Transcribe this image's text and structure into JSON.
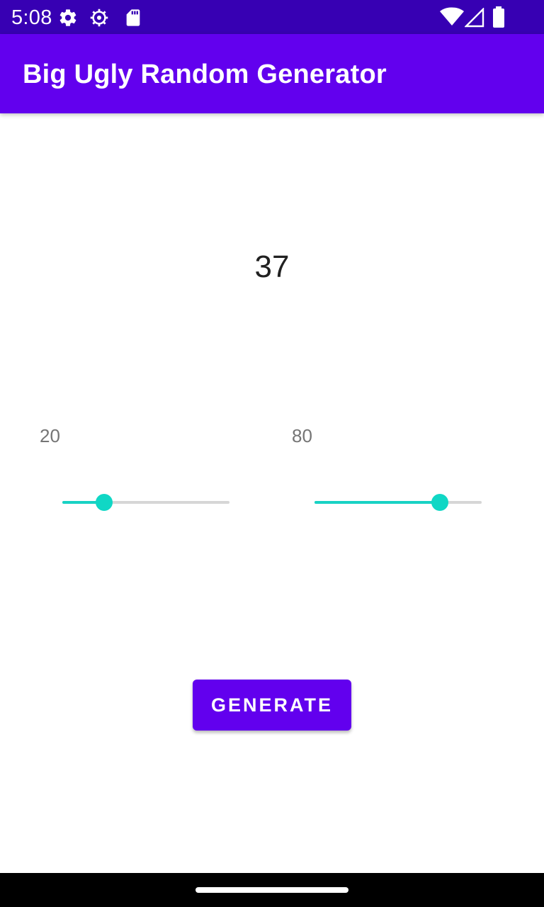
{
  "status_bar": {
    "time": "5:08",
    "icons": [
      "settings-icon",
      "gear-icon",
      "sd-card-icon",
      "wifi-icon",
      "signal-icon",
      "battery-icon"
    ]
  },
  "app_bar": {
    "title": "Big Ugly Random Generator",
    "color": "#6200ee"
  },
  "result": {
    "value": "37"
  },
  "sliders": {
    "min": {
      "label": "20",
      "fraction": 0.25
    },
    "max": {
      "label": "80",
      "fraction": 0.75
    },
    "accent_color": "#18d2c4"
  },
  "generate_button": {
    "label": "GENERATE"
  }
}
